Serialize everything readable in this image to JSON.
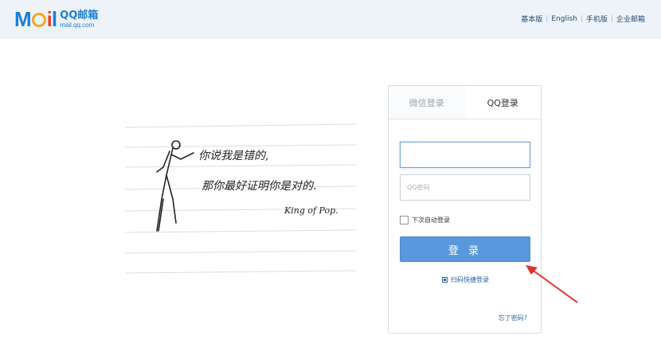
{
  "header": {
    "logo_mail": "Mail",
    "logo_title": "QQ邮箱",
    "logo_sub": "mail.qq.com",
    "links": [
      "基本版",
      "English",
      "手机版",
      "企业邮箱"
    ]
  },
  "artwork": {
    "line1": "你说我是错的,",
    "line2": "那你最好证明你是对的.",
    "signature": "King of Pop."
  },
  "login": {
    "tabs": [
      "微信登录",
      "QQ登录"
    ],
    "active_tab": "QQ登录",
    "account_value": "",
    "password_placeholder": "QQ密码",
    "remember_label": "下次自动登录",
    "login_button": "登 录",
    "qr_login": "扫码快捷登录",
    "forgot": "忘了密码?"
  },
  "colors": {
    "brand": "#1a7fd6",
    "button": "#5a98de",
    "annotation_arrow": "#e0302a"
  }
}
